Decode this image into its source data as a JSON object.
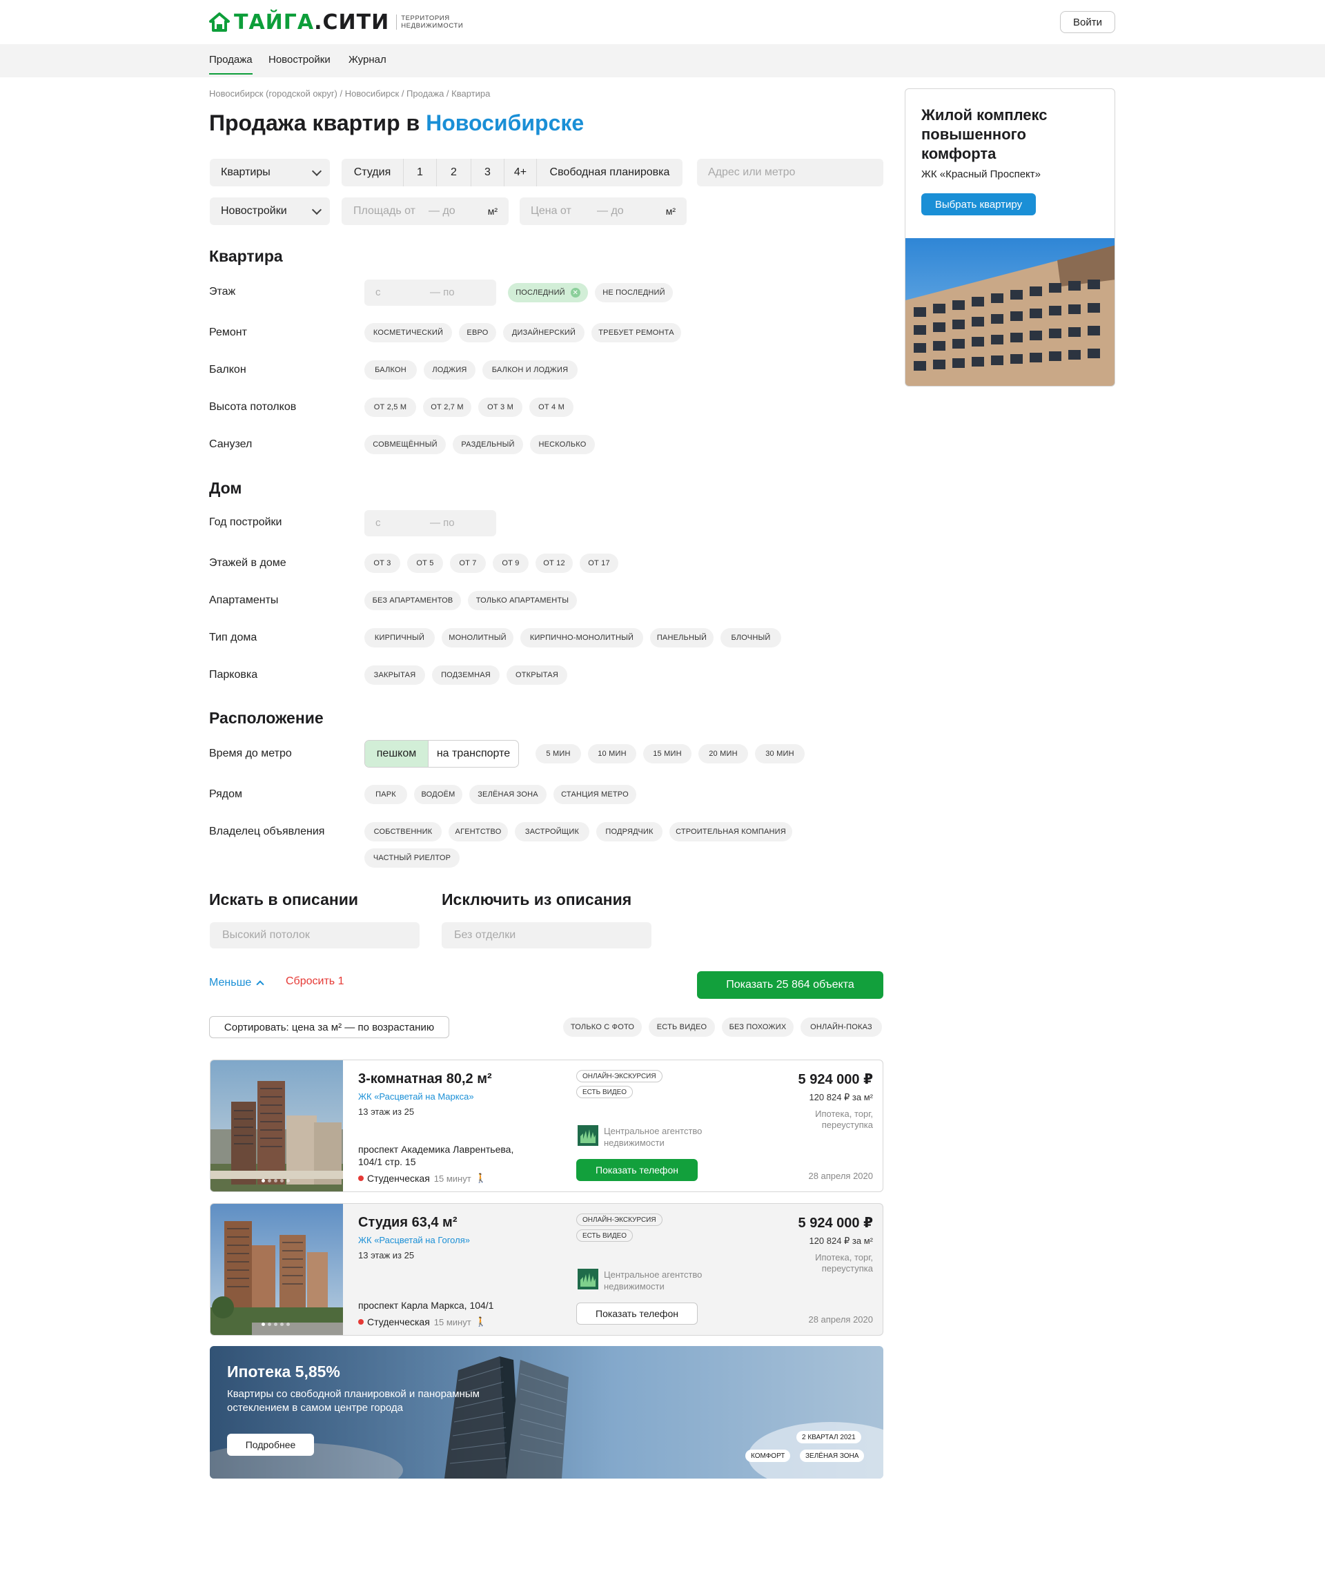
{
  "header": {
    "brand_left": "ТАЙГА",
    "brand_right": ".СИТИ",
    "tagline_1": "ТЕРРИТОРИЯ",
    "tagline_2": "НЕДВИЖИМОСТИ",
    "login_label": "Войти"
  },
  "nav": {
    "items": [
      "Продажа",
      "Новостройки",
      "Журнал"
    ],
    "active": "Продажа"
  },
  "breadcrumb": "Новосибирск (городской округ) / Новосибирск / Продажа / Квартира",
  "page_title": {
    "prefix": "Продажа квартир в ",
    "city": "Новосибирске"
  },
  "filters": {
    "type_select": "Квартиры",
    "rooms": [
      "Студия",
      "1",
      "2",
      "3",
      "4+",
      "Свободная планировка"
    ],
    "address_placeholder": "Адрес или метро",
    "market_select": "Новостройки",
    "area_from": "Площадь от",
    "area_to": "— до",
    "area_unit": "м²",
    "price_from": "Цена от",
    "price_to": "— до",
    "price_unit": "м²"
  },
  "sections": {
    "flat": {
      "title": "Квартира",
      "floor": {
        "label": "Этаж",
        "from": "с",
        "to": "— по",
        "chips": [
          "ПОСЛЕДНИЙ",
          "НЕ ПОСЛЕДНИЙ"
        ],
        "selected": "ПОСЛЕДНИЙ"
      },
      "repair": {
        "label": "Ремонт",
        "chips": [
          "КОСМЕТИЧЕСКИЙ",
          "ЕВРО",
          "ДИЗАЙНЕРСКИЙ",
          "ТРЕБУЕТ РЕМОНТА"
        ]
      },
      "balcony": {
        "label": "Балкон",
        "chips": [
          "БАЛКОН",
          "ЛОДЖИЯ",
          "БАЛКОН И ЛОДЖИЯ"
        ]
      },
      "ceiling": {
        "label": "Высота потолков",
        "chips": [
          "ОТ 2,5 М",
          "ОТ 2,7 М",
          "ОТ 3 М",
          "ОТ 4 М"
        ]
      },
      "bathroom": {
        "label": "Санузел",
        "chips": [
          "СОВМЕЩЁННЫЙ",
          "РАЗДЕЛЬНЫЙ",
          "НЕСКОЛЬКО"
        ]
      }
    },
    "house": {
      "title": "Дом",
      "year": {
        "label": "Год постройки",
        "from": "с",
        "to": "— по"
      },
      "floors": {
        "label": "Этажей в доме",
        "chips": [
          "ОТ 3",
          "ОТ 5",
          "ОТ 7",
          "ОТ 9",
          "ОТ 12",
          "ОТ 17"
        ]
      },
      "apartments": {
        "label": "Апартаменты",
        "chips": [
          "БЕЗ АПАРТАМЕНТОВ",
          "ТОЛЬКО АПАРТАМЕНТЫ"
        ]
      },
      "house_type": {
        "label": "Тип дома",
        "chips": [
          "КИРПИЧНЫЙ",
          "МОНОЛИТНЫЙ",
          "КИРПИЧНО-МОНОЛИТНЫЙ",
          "ПАНЕЛЬНЫЙ",
          "БЛОЧНЫЙ"
        ]
      },
      "parking": {
        "label": "Парковка",
        "chips": [
          "ЗАКРЫТАЯ",
          "ПОДЗЕМНАЯ",
          "ОТКРЫТАЯ"
        ]
      }
    },
    "location": {
      "title": "Расположение",
      "metro_time": {
        "label": "Время до метро",
        "modes": [
          "пешком",
          "на транспорте"
        ],
        "selected_mode": "пешком",
        "chips": [
          "5 МИН",
          "10 МИН",
          "15 МИН",
          "20 МИН",
          "30 МИН"
        ]
      },
      "nearby": {
        "label": "Рядом",
        "chips": [
          "ПАРК",
          "ВОДОЁМ",
          "ЗЕЛЁНАЯ ЗОНА",
          "СТАНЦИЯ МЕТРО"
        ]
      },
      "owner": {
        "label": "Владелец объявления",
        "chips": [
          "СОБСТВЕННИК",
          "АГЕНТСТВО",
          "ЗАСТРОЙЩИК",
          "ПОДРЯДЧИК",
          "СТРОИТЕЛЬНАЯ КОМПАНИЯ",
          "ЧАСТНЫЙ РИЕЛТОР"
        ]
      }
    },
    "description": {
      "include_title": "Искать в описании",
      "include_placeholder": "Высокий потолок",
      "exclude_title": "Исключить из описания",
      "exclude_placeholder": "Без отделки"
    }
  },
  "actions": {
    "less_label": "Меньше",
    "reset_label": "Сбросить 1",
    "show_label": "Показать 25 864 объекта",
    "sort_label": "Сортировать: цена за м² — по возрастанию",
    "quick_filters": [
      "ТОЛЬКО С ФОТО",
      "ЕСТЬ ВИДЕО",
      "БЕЗ ПОХОЖИХ",
      "ОНЛАЙН-ПОКАЗ"
    ]
  },
  "listings": [
    {
      "title": "3-комнатная 80,2 м²",
      "complex": "ЖК «Расцветай на Маркса»",
      "floor": "13 этаж из 25",
      "address": "проспект Академика Лаврентьева, 104/1 стр. 15",
      "metro": "Студенческая",
      "metro_time": "15 минут",
      "tags": [
        "ОНЛАЙН-ЭКСКУРСИЯ",
        "ЕСТЬ ВИДЕО"
      ],
      "agency": "Центральное агентство недвижимости",
      "phone_label": "Показать телефон",
      "price": "5 924 000 ₽",
      "price_per_m2": "120 824 ₽ за м²",
      "terms": "Ипотека, торг, переуступка",
      "date": "28 апреля 2020"
    },
    {
      "title": "Студия 63,4 м²",
      "complex": "ЖК «Расцветай на Гоголя»",
      "floor": "13 этаж из 25",
      "address": "проспект Карла Маркса, 104/1",
      "metro": "Студенческая",
      "metro_time": "15 минут",
      "tags": [
        "ОНЛАЙН-ЭКСКУРСИЯ",
        "ЕСТЬ ВИДЕО"
      ],
      "agency": "Центральное агентство недвижимости",
      "phone_label": "Показать телефон",
      "price": "5 924 000 ₽",
      "price_per_m2": "120 824 ₽ за м²",
      "terms": "Ипотека, торг, переуступка",
      "date": "28 апреля 2020"
    }
  ],
  "promo_banner": {
    "title": "Ипотека 5,85%",
    "subtitle": "Квартиры со свободной планировкой и панорамным остеклением в самом центре города",
    "button": "Подробнее",
    "tags": [
      "2 КВАРТАЛ 2021",
      "КОМФОРТ",
      "ЗЕЛЁНАЯ ЗОНА"
    ]
  },
  "side_ad": {
    "title": "Жилой комплекс повышенного комфорта",
    "subtitle": "ЖК «Красный Проспект»",
    "button": "Выбрать квартиру"
  },
  "colors": {
    "brand_green": "#0d9e3a",
    "accent_blue": "#1a8fd6",
    "action_green": "#12a03c",
    "reset_red": "#e53935",
    "chip_bg": "#f1f1f1",
    "chip_selected_bg": "#d2eed7"
  }
}
